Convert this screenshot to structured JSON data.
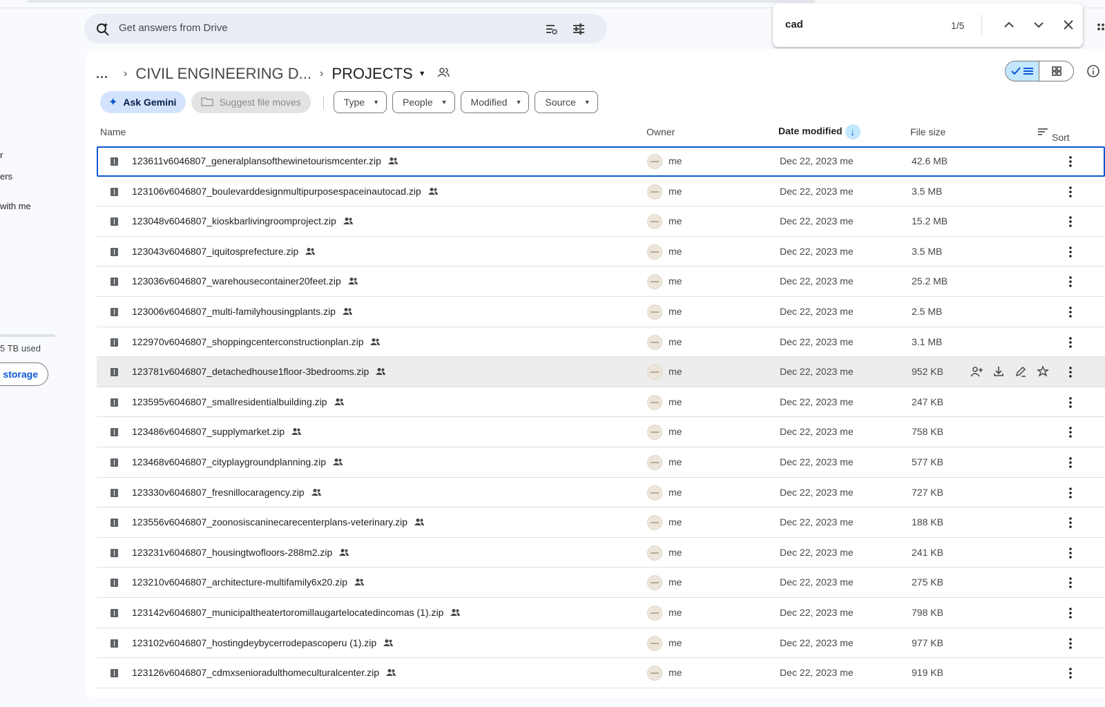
{
  "sidebar": {
    "items": [
      {
        "label": "r"
      },
      {
        "label": "ers"
      },
      {
        "label": "with me"
      }
    ],
    "storage_used": "5 TB used",
    "storage_button": "storage"
  },
  "search": {
    "placeholder": "Get answers from Drive",
    "icons": [
      "ai-search-icon",
      "search-options-icon",
      "filter-tune-icon"
    ]
  },
  "find_bar": {
    "query": "cad",
    "count": "1/5"
  },
  "breadcrumb": {
    "overflow": "...",
    "parent": "CIVIL ENGINEERING D...",
    "current": "PROJECTS"
  },
  "toolbar": {
    "ask_gemini": "Ask Gemini",
    "suggest_moves": "Suggest file moves",
    "filters": [
      "Type",
      "People",
      "Modified",
      "Source"
    ]
  },
  "table": {
    "columns": {
      "name": "Name",
      "owner": "Owner",
      "date_modified": "Date modified",
      "file_size": "File size",
      "sort": "Sort"
    },
    "rows": [
      {
        "name": "123611v6046807_generalplansofthewinetourismcenter.zip",
        "owner": "me",
        "date": "Dec 22, 2023 me",
        "size": "42.6 MB"
      },
      {
        "name": "123106v6046807_boulevarddesignmultipurposespaceinautocad.zip",
        "owner": "me",
        "date": "Dec 22, 2023 me",
        "size": "3.5 MB"
      },
      {
        "name": "123048v6046807_kioskbarlivingroomproject.zip",
        "owner": "me",
        "date": "Dec 22, 2023 me",
        "size": "15.2 MB"
      },
      {
        "name": "123043v6046807_iquitosprefecture.zip",
        "owner": "me",
        "date": "Dec 22, 2023 me",
        "size": "3.5 MB"
      },
      {
        "name": "123036v6046807_warehousecontainer20feet.zip",
        "owner": "me",
        "date": "Dec 22, 2023 me",
        "size": "25.2 MB"
      },
      {
        "name": "123006v6046807_multi-familyhousingplants.zip",
        "owner": "me",
        "date": "Dec 22, 2023 me",
        "size": "2.5 MB"
      },
      {
        "name": "122970v6046807_shoppingcenterconstructionplan.zip",
        "owner": "me",
        "date": "Dec 22, 2023 me",
        "size": "3.1 MB"
      },
      {
        "name": "123781v6046807_detachedhouse1floor-3bedrooms.zip",
        "owner": "me",
        "date": "Dec 22, 2023 me",
        "size": "952 KB"
      },
      {
        "name": "123595v6046807_smallresidentialbuilding.zip",
        "owner": "me",
        "date": "Dec 22, 2023 me",
        "size": "247 KB"
      },
      {
        "name": "123486v6046807_supplymarket.zip",
        "owner": "me",
        "date": "Dec 22, 2023 me",
        "size": "758 KB"
      },
      {
        "name": "123468v6046807_cityplaygroundplanning.zip",
        "owner": "me",
        "date": "Dec 22, 2023 me",
        "size": "577 KB"
      },
      {
        "name": "123330v6046807_fresnillocaragency.zip",
        "owner": "me",
        "date": "Dec 22, 2023 me",
        "size": "727 KB"
      },
      {
        "name": "123556v6046807_zoonosiscaninecarecenterplans-veterinary.zip",
        "owner": "me",
        "date": "Dec 22, 2023 me",
        "size": "188 KB"
      },
      {
        "name": "123231v6046807_housingtwofloors-288m2.zip",
        "owner": "me",
        "date": "Dec 22, 2023 me",
        "size": "241 KB"
      },
      {
        "name": "123210v6046807_architecture-multifamily6x20.zip",
        "owner": "me",
        "date": "Dec 22, 2023 me",
        "size": "275 KB"
      },
      {
        "name": "123142v6046807_municipaltheatertoromillaugartelocatedincomas (1).zip",
        "owner": "me",
        "date": "Dec 22, 2023 me",
        "size": "798 KB"
      },
      {
        "name": "123102v6046807_hostingdeybycerrodepascoperu (1).zip",
        "owner": "me",
        "date": "Dec 22, 2023 me",
        "size": "977 KB"
      },
      {
        "name": "123126v6046807_cdmxsenioradulthomeculturalcenter.zip",
        "owner": "me",
        "date": "Dec 22, 2023 me",
        "size": "919 KB"
      }
    ],
    "selected_row": 0,
    "hovered_row": 7,
    "hover_actions": [
      "share-icon",
      "download-icon",
      "rename-icon",
      "star-icon"
    ]
  },
  "colors": {
    "accent": "#0b57d0",
    "selected_bg": "#c2e7ff",
    "gemini_chip": "#d3e3fd"
  }
}
